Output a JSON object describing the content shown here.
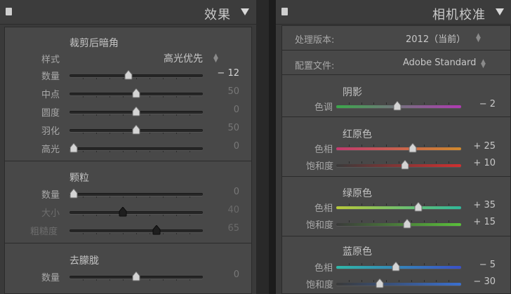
{
  "effects": {
    "title": "效果",
    "crop_vignette": {
      "title": "裁剪后暗角",
      "style_label": "样式",
      "style_value": "高光优先",
      "rows": [
        {
          "label": "数量",
          "value": "− 12",
          "pos": 0.44,
          "dim": false
        },
        {
          "label": "中点",
          "value": "50",
          "pos": 0.5,
          "dim": false
        },
        {
          "label": "圆度",
          "value": "0",
          "pos": 0.5,
          "dim": false
        },
        {
          "label": "羽化",
          "value": "50",
          "pos": 0.5,
          "dim": false
        },
        {
          "label": "高光",
          "value": "0",
          "pos": 0.03,
          "dim": false
        }
      ]
    },
    "grain": {
      "title": "颗粒",
      "rows": [
        {
          "label": "数量",
          "value": "0",
          "pos": 0.03,
          "dim": false
        },
        {
          "label": "大小",
          "value": "40",
          "pos": 0.4,
          "dim": true
        },
        {
          "label": "粗糙度",
          "value": "65",
          "pos": 0.65,
          "dim": true
        }
      ]
    },
    "dehaze": {
      "title": "去朦胧",
      "rows": [
        {
          "label": "数量",
          "value": "0",
          "pos": 0.5,
          "dim": false
        }
      ]
    }
  },
  "calibration": {
    "title": "相机校准",
    "process_label": "处理版本:",
    "process_value": "2012（当前）",
    "profile_label": "配置文件:",
    "profile_value": "Adobe Standard",
    "shadows": {
      "title": "阴影",
      "rows": [
        {
          "label": "色调",
          "value": "− 2",
          "pos": 0.49,
          "colors": [
            "#3aa84a",
            "#b03ab3"
          ]
        }
      ]
    },
    "red_primary": {
      "title": "红原色",
      "rows": [
        {
          "label": "色相",
          "value": "+ 25",
          "pos": 0.61,
          "colors": [
            "#c23a6e",
            "#d08a2e"
          ]
        },
        {
          "label": "饱和度",
          "value": "+ 10",
          "pos": 0.55,
          "colors": [
            "#3a3a3a",
            "#d03030"
          ]
        }
      ]
    },
    "green_primary": {
      "title": "绿原色",
      "rows": [
        {
          "label": "色相",
          "value": "+ 35",
          "pos": 0.66,
          "colors": [
            "#b8c83a",
            "#30b89a"
          ]
        },
        {
          "label": "饱和度",
          "value": "+ 15",
          "pos": 0.57,
          "colors": [
            "#3a3a3a",
            "#5ac03a"
          ]
        }
      ]
    },
    "blue_primary": {
      "title": "蓝原色",
      "rows": [
        {
          "label": "色相",
          "value": "− 5",
          "pos": 0.48,
          "colors": [
            "#30b8a8",
            "#3a50c8"
          ]
        },
        {
          "label": "饱和度",
          "value": "− 30",
          "pos": 0.35,
          "colors": [
            "#3a3a3a",
            "#3a70d0"
          ]
        }
      ]
    }
  }
}
